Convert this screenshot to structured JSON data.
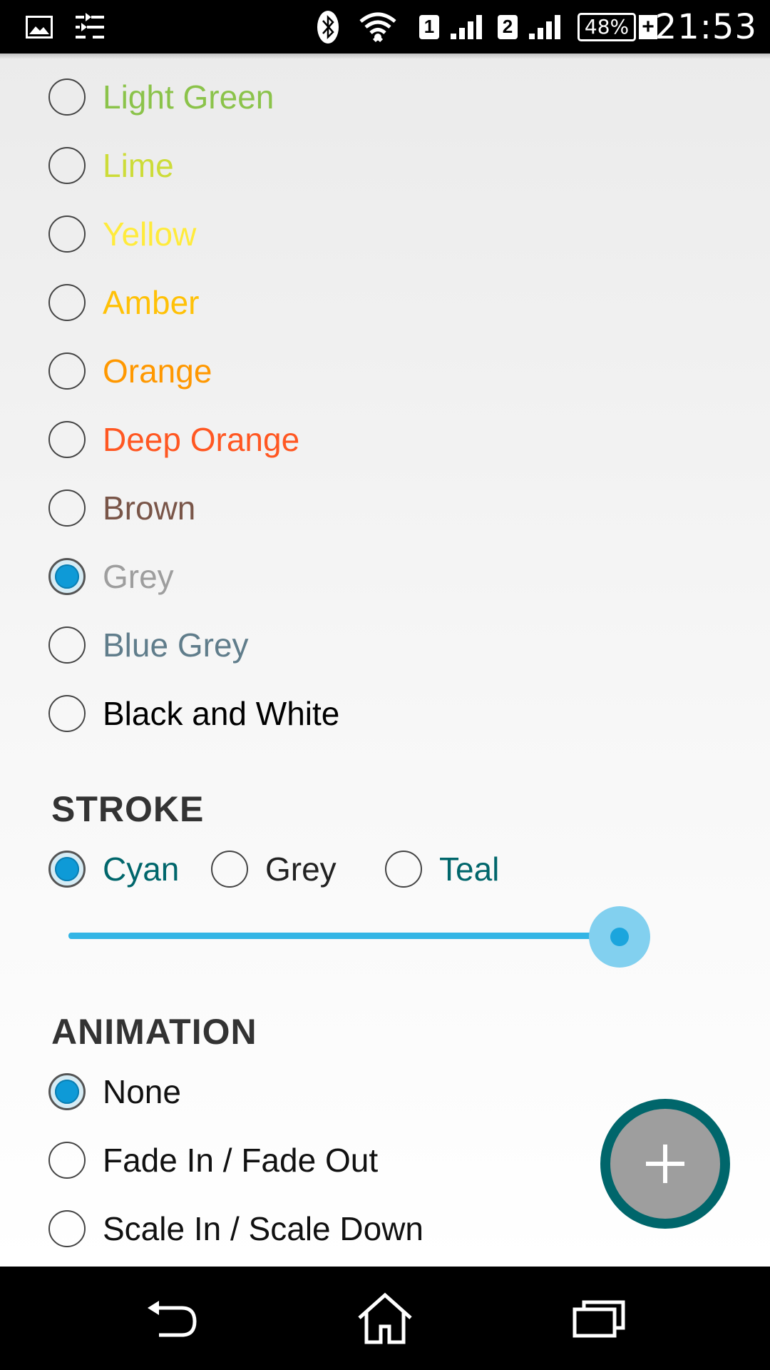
{
  "status_bar": {
    "time": "21:53",
    "battery_percent": "48%",
    "sim1_label": "1",
    "sim2_label": "2",
    "charging_symbol": "+",
    "icons": [
      "image-icon",
      "equalizer-icon",
      "bluetooth-icon",
      "wifi-icon",
      "signal-icon",
      "battery-icon"
    ]
  },
  "fill_options": [
    {
      "label": "Light Green",
      "color": "#8bc34a",
      "checked": false
    },
    {
      "label": "Lime",
      "color": "#cddc39",
      "checked": false
    },
    {
      "label": "Yellow",
      "color": "#ffeb3b",
      "checked": false
    },
    {
      "label": "Amber",
      "color": "#ffc107",
      "checked": false
    },
    {
      "label": "Orange",
      "color": "#ff9800",
      "checked": false
    },
    {
      "label": "Deep Orange",
      "color": "#ff5722",
      "checked": false
    },
    {
      "label": "Brown",
      "color": "#795548",
      "checked": false
    },
    {
      "label": "Grey",
      "color": "#9e9e9e",
      "checked": true
    },
    {
      "label": "Blue Grey",
      "color": "#607d8b",
      "checked": false
    },
    {
      "label": "Black and White",
      "color": "#000000",
      "checked": false
    }
  ],
  "stroke": {
    "title": "STROKE",
    "options": [
      {
        "label": "Cyan",
        "color": "#00666b",
        "checked": true
      },
      {
        "label": "Grey",
        "color": "#222222",
        "checked": false
      },
      {
        "label": "Teal",
        "color": "#00666b",
        "checked": false
      }
    ],
    "slider_fraction": 0.96
  },
  "animation": {
    "title": "ANIMATION",
    "options": [
      {
        "label": "None",
        "checked": true
      },
      {
        "label": "Fade In / Fade Out",
        "checked": false
      },
      {
        "label": "Scale In / Scale Down",
        "checked": false
      }
    ]
  },
  "fab": {
    "icon": "plus-icon",
    "background": "#9e9e9e",
    "ring": "#00666b"
  },
  "nav_bar": {
    "icons": [
      "back-icon",
      "home-icon",
      "recents-icon"
    ]
  }
}
